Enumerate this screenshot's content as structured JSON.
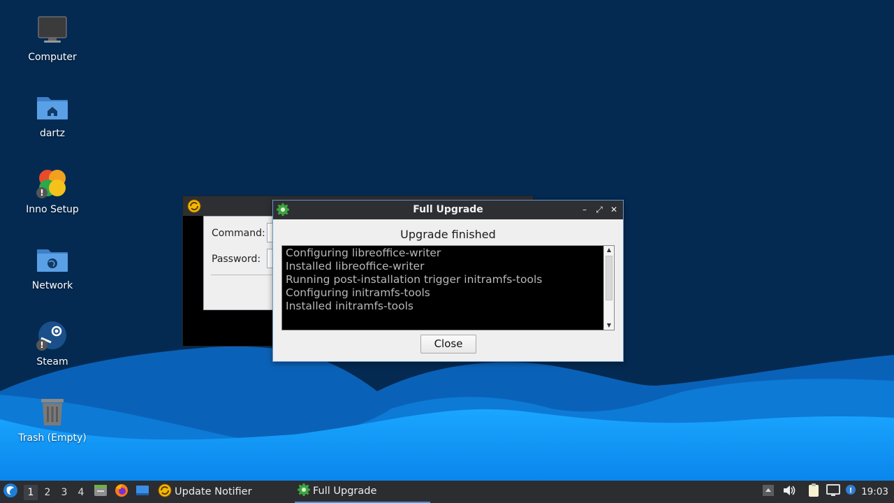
{
  "colors": {
    "sky": "#042a52",
    "wave_light": "#1aa0ff",
    "wave_mid": "#0b7fe0",
    "taskbar": "#2b2d31",
    "titlebar": "#2d2f33",
    "accent": "#4a90d9"
  },
  "desktop": {
    "icons": [
      {
        "label": "Computer",
        "icon": "computer-icon"
      },
      {
        "label": "dartz",
        "icon": "home-folder-icon"
      },
      {
        "label": "Inno Setup",
        "icon": "inno-setup-icon"
      },
      {
        "label": "Network",
        "icon": "network-folder-icon"
      },
      {
        "label": "Steam",
        "icon": "steam-icon"
      },
      {
        "label": "Trash (Empty)",
        "icon": "trash-icon"
      }
    ]
  },
  "background_window": {
    "command_label": "Command:",
    "password_label": "Password:"
  },
  "dialog": {
    "title": "Full Upgrade",
    "message": "Upgrade finished",
    "log_lines": [
      "Configuring libreoffice-writer",
      "Installed libreoffice-writer",
      "Running post-installation trigger initramfs-tools",
      "Configuring initramfs-tools",
      "Installed initramfs-tools"
    ],
    "close_label": "Close",
    "minimize_glyph": "–",
    "maximize_glyph": "⤢",
    "close_glyph": "✕"
  },
  "taskbar": {
    "workspaces": [
      "1",
      "2",
      "3",
      "4"
    ],
    "active_workspace": "1",
    "tasks": [
      {
        "label": "Update Notifier",
        "icon": "update-notifier-icon"
      },
      {
        "label": "Full Upgrade",
        "icon": "gear-icon"
      }
    ],
    "clock": "19:03"
  }
}
